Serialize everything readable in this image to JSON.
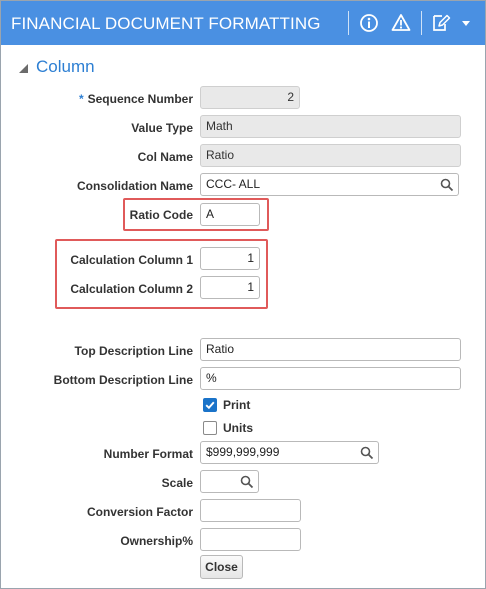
{
  "window": {
    "title": "FINANCIAL DOCUMENT FORMATTING",
    "icons": [
      "info-icon",
      "warning-icon",
      "edit-icon",
      "dropdown-icon"
    ]
  },
  "section": {
    "title": "Column"
  },
  "fields": {
    "sequence_number": {
      "label": "Sequence Number",
      "required_mark": "*",
      "value": "2"
    },
    "value_type": {
      "label": "Value Type",
      "value": "Math"
    },
    "col_name": {
      "label": "Col Name",
      "value": "Ratio"
    },
    "consolidation_name": {
      "label": "Consolidation Name",
      "value": "CCC- ALL"
    },
    "ratio_code": {
      "label": "Ratio Code",
      "value": "A"
    },
    "calculation_column_1": {
      "label": "Calculation Column 1",
      "value": "1"
    },
    "calculation_column_2": {
      "label": "Calculation Column 2",
      "value": "1"
    },
    "top_description_line": {
      "label": "Top Description Line",
      "value": "Ratio"
    },
    "bottom_description_line": {
      "label": "Bottom Description Line",
      "value": "%"
    },
    "print": {
      "label": "Print",
      "checked": true
    },
    "units": {
      "label": "Units",
      "checked": false
    },
    "number_format": {
      "label": "Number Format",
      "value": "$999,999,999"
    },
    "scale": {
      "label": "Scale",
      "value": ""
    },
    "conversion_factor": {
      "label": "Conversion Factor",
      "value": ""
    },
    "ownership": {
      "label": "Ownership%",
      "value": ""
    }
  },
  "buttons": {
    "close": "Close"
  },
  "colors": {
    "titlebar": "#4a90e2",
    "accent": "#2d7fd3",
    "highlight": "#e05a5a",
    "checkbox": "#1a73c9"
  }
}
